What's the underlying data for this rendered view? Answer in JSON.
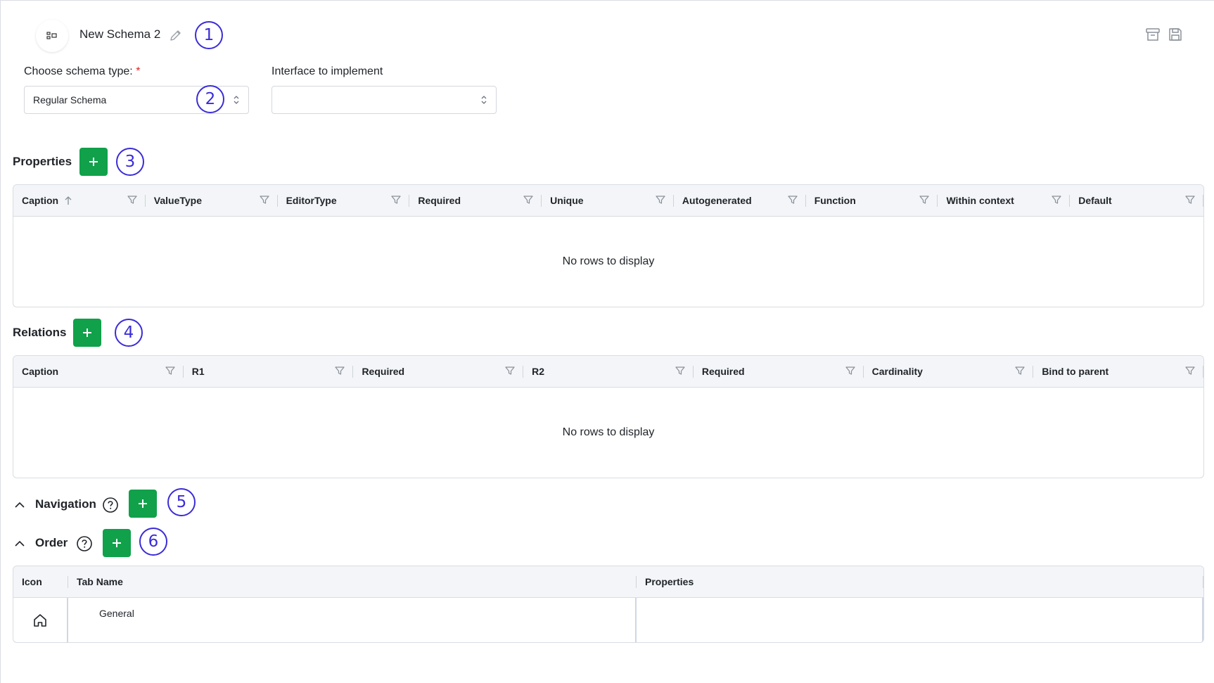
{
  "header": {
    "schema_name": "New Schema 2",
    "schema_icon": "schema-icon",
    "top_icons": [
      "archive-icon",
      "save-icon"
    ]
  },
  "callouts": [
    "1",
    "2",
    "3",
    "4",
    "5",
    "6"
  ],
  "form": {
    "schema_type_label": "Choose schema type:",
    "required_mark": "*",
    "schema_type_value": "Regular Schema",
    "interface_label": "Interface to implement",
    "interface_value": ""
  },
  "properties": {
    "title": "Properties",
    "columns": [
      "Caption",
      "ValueType",
      "EditorType",
      "Required",
      "Unique",
      "Autogenerated",
      "Function",
      "Within context",
      "Default"
    ],
    "empty_text": "No rows to display"
  },
  "relations": {
    "title": "Relations",
    "columns": [
      "Caption",
      "R1",
      "Required",
      "R2",
      "Required",
      "Cardinality",
      "Bind to parent"
    ],
    "empty_text": "No rows to display"
  },
  "navigation": {
    "title": "Navigation"
  },
  "order": {
    "title": "Order",
    "columns": [
      "Icon",
      "Tab Name",
      "Properties"
    ],
    "rows": [
      {
        "icon": "home-icon",
        "tab_name": "General",
        "properties": ""
      }
    ]
  },
  "colors": {
    "accent_green": "#10a14a",
    "callout": "#3a2cd8",
    "required": "#e02424"
  }
}
